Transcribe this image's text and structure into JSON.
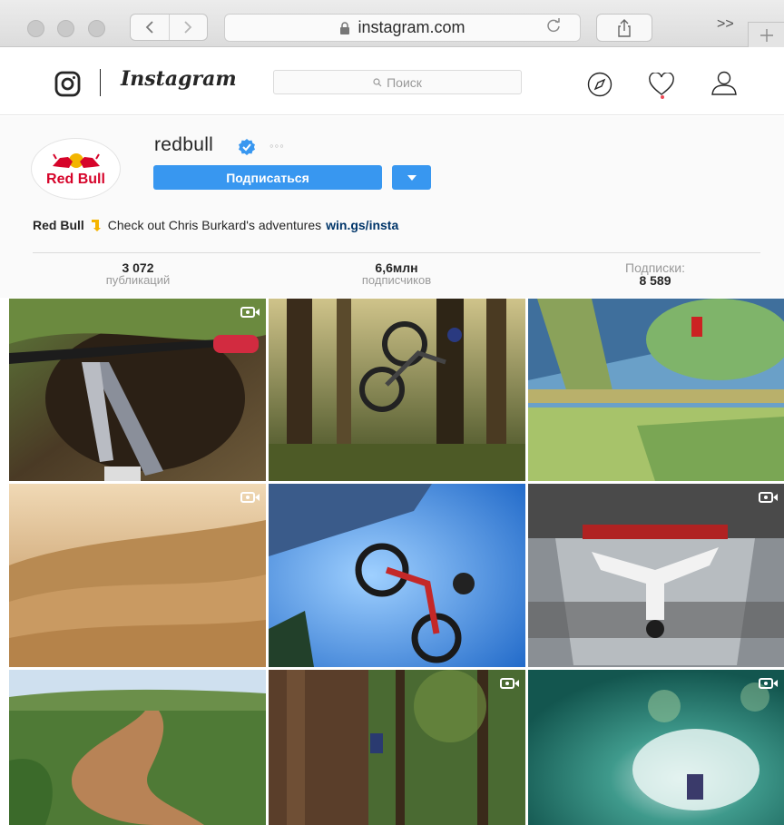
{
  "browser": {
    "url": "instagram.com",
    "overflow_label": ">>"
  },
  "instagram": {
    "wordmark": "Instagram",
    "search_placeholder": "Поиск"
  },
  "profile": {
    "avatar_text": "Red Bull",
    "username": "redbull",
    "options_label": "◦◦◦",
    "follow_label": "Подписаться",
    "bio": {
      "name": "Red Bull",
      "text": "Check out Chris Burkard's adventures",
      "link": "win.gs/insta"
    },
    "stats": [
      {
        "value": "3 072",
        "label": "публикаций"
      },
      {
        "value": "6,6млн",
        "label": "подписчиков"
      },
      {
        "label": "Подписки:",
        "value": "8 589"
      }
    ]
  },
  "grid": {
    "tiles": [
      {
        "name": "mtb-forest-pov",
        "video": true
      },
      {
        "name": "bike-jump-forest",
        "video": false
      },
      {
        "name": "skate-pipes",
        "video": false
      },
      {
        "name": "desert-dunes",
        "video": true
      },
      {
        "name": "bike-sky-jump",
        "video": false
      },
      {
        "name": "indoor-skydive",
        "video": true
      },
      {
        "name": "river-valley",
        "video": false
      },
      {
        "name": "tree-climber",
        "video": true
      },
      {
        "name": "water-jetski",
        "video": true
      }
    ]
  },
  "colors": {
    "follow_blue": "#3897f0",
    "link_blue": "#003569",
    "redbull_red": "#d6042a",
    "notification_red": "#ed4956"
  }
}
